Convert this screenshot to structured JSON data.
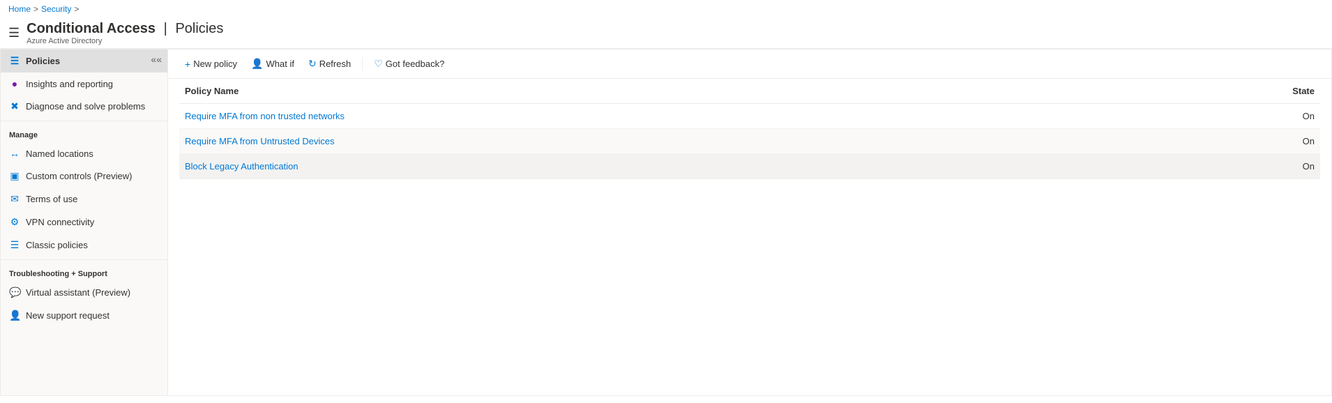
{
  "breadcrumb": {
    "items": [
      "Home",
      "Security"
    ]
  },
  "header": {
    "title": "Conditional Access",
    "separator": "|",
    "subtitle_right": "Policies",
    "service": "Azure Active Directory"
  },
  "toolbar": {
    "new_policy": "New policy",
    "what_if": "What if",
    "refresh": "Refresh",
    "feedback": "Got feedback?"
  },
  "sidebar": {
    "collapse_title": "Collapse",
    "items_top": [
      {
        "id": "policies",
        "label": "Policies",
        "icon": "≡",
        "active": true
      },
      {
        "id": "insights",
        "label": "Insights and reporting",
        "icon": "📍"
      },
      {
        "id": "diagnose",
        "label": "Diagnose and solve problems",
        "icon": "✂"
      }
    ],
    "manage_section": "Manage",
    "manage_items": [
      {
        "id": "named-locations",
        "label": "Named locations",
        "icon": "↔"
      },
      {
        "id": "custom-controls",
        "label": "Custom controls (Preview)",
        "icon": "⊞"
      },
      {
        "id": "terms-of-use",
        "label": "Terms of use",
        "icon": "✉"
      },
      {
        "id": "vpn-connectivity",
        "label": "VPN connectivity",
        "icon": "⚙"
      },
      {
        "id": "classic-policies",
        "label": "Classic policies",
        "icon": "≡"
      }
    ],
    "troubleshooting_section": "Troubleshooting + Support",
    "troubleshooting_items": [
      {
        "id": "virtual-assistant",
        "label": "Virtual assistant (Preview)",
        "icon": "💬"
      },
      {
        "id": "new-support",
        "label": "New support request",
        "icon": "👤"
      }
    ]
  },
  "table": {
    "columns": [
      {
        "id": "policy-name",
        "label": "Policy Name"
      },
      {
        "id": "state",
        "label": "State"
      }
    ],
    "rows": [
      {
        "name": "Require MFA from non trusted networks",
        "state": "On"
      },
      {
        "name": "Require MFA from Untrusted Devices",
        "state": "On"
      },
      {
        "name": "Block Legacy Authentication",
        "state": "On"
      }
    ]
  }
}
